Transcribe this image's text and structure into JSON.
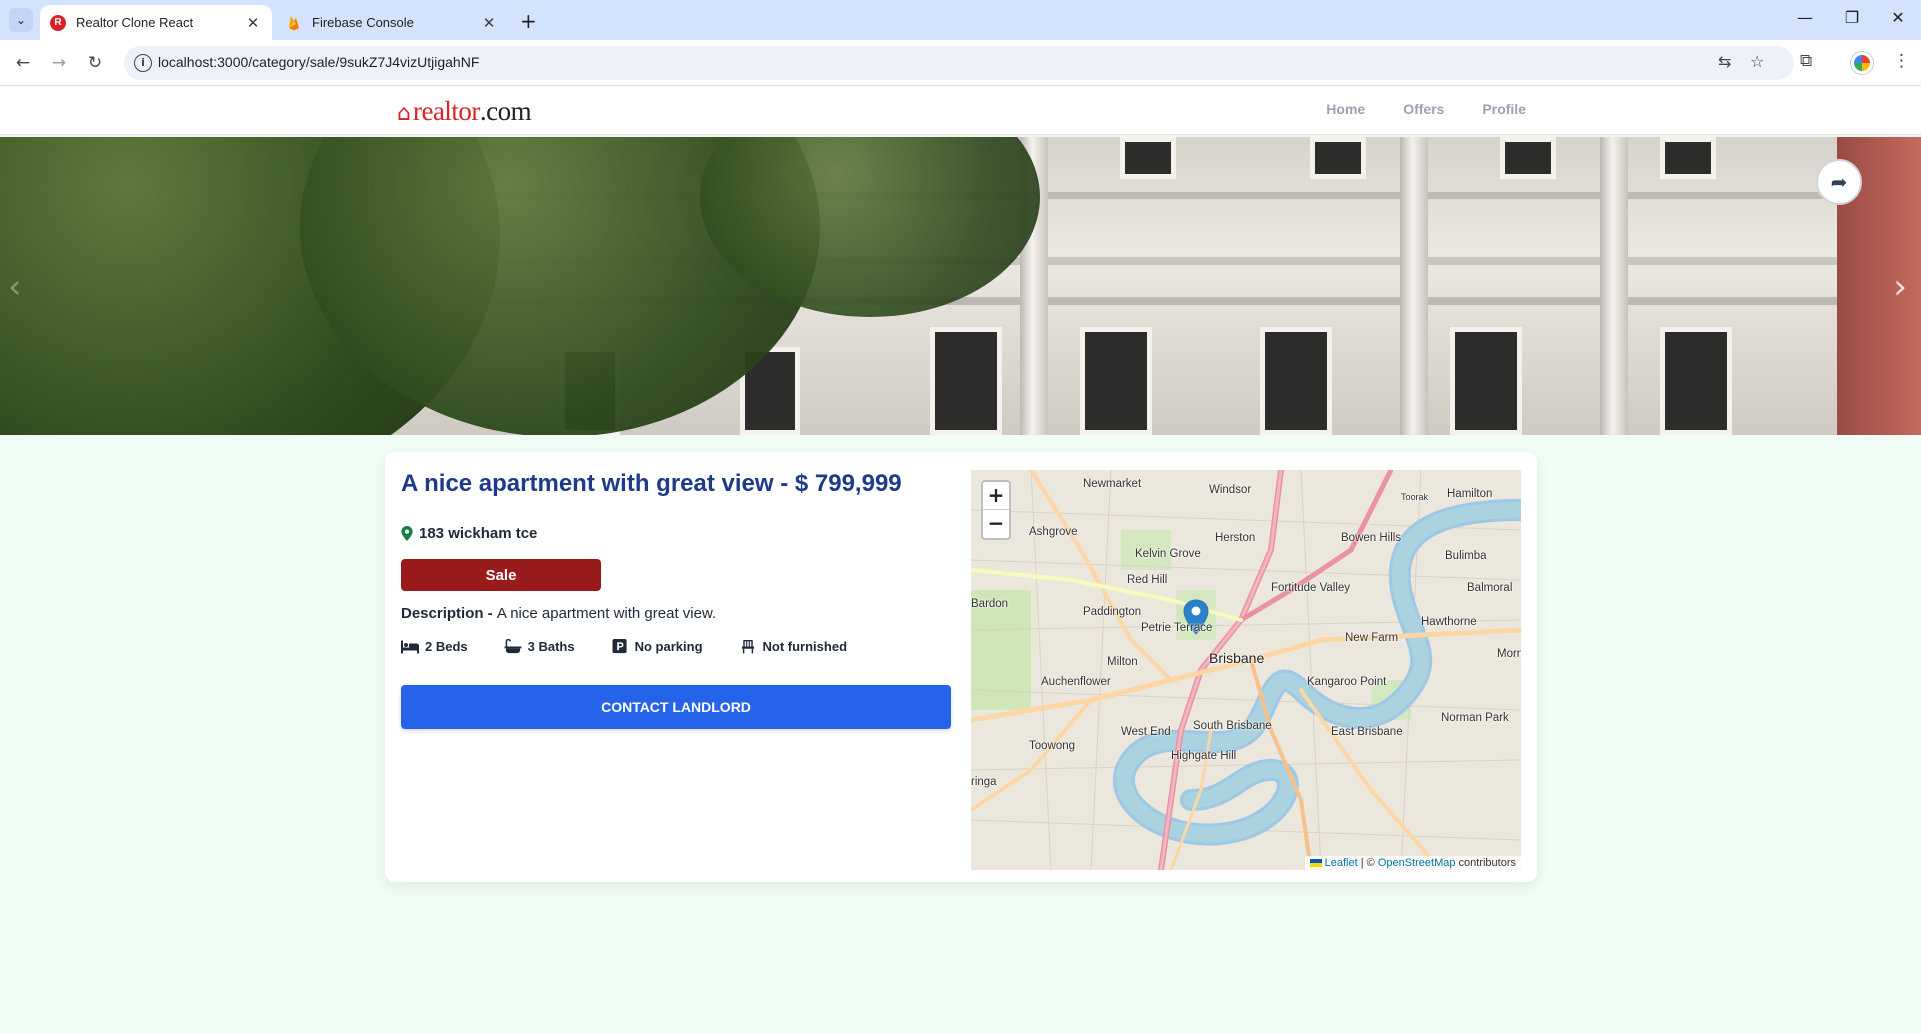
{
  "browser": {
    "tabs": [
      {
        "title": "Realtor Clone React",
        "active": true
      },
      {
        "title": "Firebase Console",
        "active": false
      }
    ],
    "url": "localhost:3000/category/sale/9sukZ7J4vizUtjigahNF"
  },
  "header": {
    "logo_main": "realtor",
    "logo_suffix": ".com",
    "nav": [
      "Home",
      "Offers",
      "Profile"
    ]
  },
  "listing": {
    "title": "A nice apartment with great view - $ 799,999",
    "address": "183 wickham tce",
    "badge": "Sale",
    "description_label": "Description - ",
    "description": "A nice apartment with great view.",
    "features": {
      "beds": "2 Beds",
      "baths": "3 Baths",
      "parking": "No parking",
      "furnished": "Not furnished"
    },
    "contact_label": "CONTACT LANDLORD"
  },
  "map": {
    "zoom_in": "+",
    "zoom_out": "−",
    "attribution_leaflet": "Leaflet",
    "attribution_sep": " | © ",
    "attribution_osm": "OpenStreetMap",
    "attribution_tail": " contributors",
    "places": [
      "Newmarket",
      "Windsor",
      "Toorak",
      "Hamilton",
      "Ashgrove",
      "Herston",
      "Bowen Hills",
      "Kelvin Grove",
      "Bulimba",
      "Red Hill",
      "Fortitude Valley",
      "Balmoral",
      "Bardon",
      "Paddington",
      "Hawthorne",
      "Petrie Terrace",
      "New Farm",
      "Milton",
      "Brisbane",
      "Morn",
      "Auchenflower",
      "Kangaroo Point",
      "Norman Park",
      "West End",
      "South Brisbane",
      "East Brisbane",
      "Toowong",
      "Highgate Hill",
      "ringa"
    ]
  },
  "colors": {
    "title": "#1e3a8a",
    "badge": "#991b1b",
    "button": "#2563eb",
    "page_bg": "#f0fdf4"
  }
}
